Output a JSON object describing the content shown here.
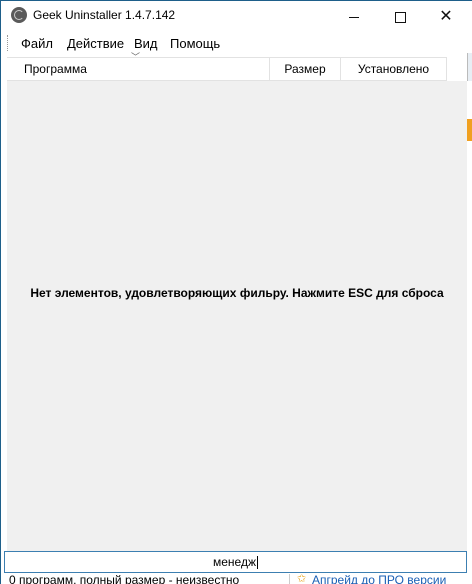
{
  "window": {
    "title": "Geek Uninstaller 1.4.7.142",
    "icon": "app-icon",
    "controls": {
      "minimize": "minimize-icon",
      "maximize": "maximize-icon",
      "close": "close-icon"
    }
  },
  "menu": {
    "file": "Файл",
    "action": "Действие",
    "view": "Вид",
    "help": "Помощь"
  },
  "table": {
    "columns": [
      "Программа",
      "Размер",
      "Установлено"
    ],
    "sort_indicator": "chevron-down-icon",
    "empty_message": "Нет элементов, удовлетворяющих фильру. Нажмите ESC для сброса"
  },
  "search": {
    "value": "менедж"
  },
  "status": {
    "summary": "0 программ, полный размер - неизвестно",
    "upgrade_link": "Апгрейд до ПРО версии",
    "upgrade_icon": "star-icon"
  },
  "colors": {
    "list_background": "#f0f0f0",
    "search_border": "#3c7fb1",
    "link": "#1a5fb4"
  }
}
